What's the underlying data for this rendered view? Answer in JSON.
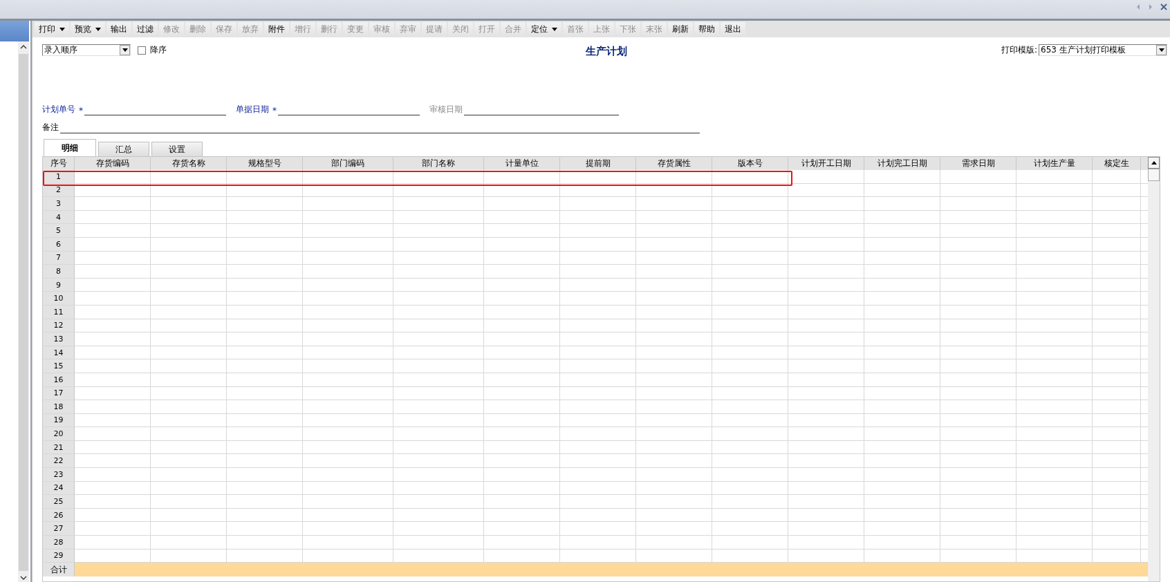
{
  "toolbar": [
    {
      "label": "打印",
      "kind": "dropdown",
      "disabled": false
    },
    {
      "label": "预览",
      "kind": "dropdown",
      "disabled": false
    },
    {
      "label": "输出",
      "kind": "button",
      "disabled": false
    },
    {
      "label": "过滤",
      "kind": "button",
      "disabled": false
    },
    {
      "label": "修改",
      "kind": "button",
      "disabled": true
    },
    {
      "label": "删除",
      "kind": "button",
      "disabled": true
    },
    {
      "label": "保存",
      "kind": "button",
      "disabled": true
    },
    {
      "label": "放弃",
      "kind": "button",
      "disabled": true
    },
    {
      "label": "附件",
      "kind": "button",
      "disabled": false
    },
    {
      "label": "增行",
      "kind": "button",
      "disabled": true
    },
    {
      "label": "删行",
      "kind": "button",
      "disabled": true
    },
    {
      "label": "变更",
      "kind": "button",
      "disabled": true
    },
    {
      "label": "审核",
      "kind": "button",
      "disabled": true
    },
    {
      "label": "弃审",
      "kind": "button",
      "disabled": true
    },
    {
      "label": "提请",
      "kind": "button",
      "disabled": true
    },
    {
      "label": "关闭",
      "kind": "button",
      "disabled": true
    },
    {
      "label": "打开",
      "kind": "button",
      "disabled": true
    },
    {
      "label": "合并",
      "kind": "button",
      "disabled": true
    },
    {
      "label": "定位",
      "kind": "dropdown",
      "disabled": false
    },
    {
      "label": "首张",
      "kind": "button",
      "disabled": true
    },
    {
      "label": "上张",
      "kind": "button",
      "disabled": true
    },
    {
      "label": "下张",
      "kind": "button",
      "disabled": true
    },
    {
      "label": "末张",
      "kind": "button",
      "disabled": true
    },
    {
      "label": "刷新",
      "kind": "button",
      "disabled": false
    },
    {
      "label": "帮助",
      "kind": "button",
      "disabled": false
    },
    {
      "label": "退出",
      "kind": "button",
      "disabled": false
    }
  ],
  "sort": {
    "value": "录入顺序",
    "descending": {
      "label": "降序",
      "checked": false
    }
  },
  "title": "生产计划",
  "print_template": {
    "label": "打印模版:",
    "value": "653 生产计划打印模板"
  },
  "fields": [
    {
      "label": "计划单号",
      "required": true,
      "required_mark": "*",
      "disabled": false
    },
    {
      "label": "单据日期",
      "required": true,
      "required_mark": "*",
      "disabled": false
    },
    {
      "label": "审核日期",
      "required": false,
      "disabled": true
    }
  ],
  "remark": {
    "label": "备注"
  },
  "tabs": [
    {
      "label": "明细",
      "selected": true
    },
    {
      "label": "汇总",
      "selected": false
    },
    {
      "label": "设置",
      "selected": false
    }
  ],
  "grid": {
    "corner_label": "序号",
    "columns": [
      "存货编码",
      "存货名称",
      "规格型号",
      "部门编码",
      "部门名称",
      "计量单位",
      "提前期",
      "存货属性",
      "版本号",
      "计划开工日期",
      "计划完工日期",
      "需求日期",
      "计划生产量",
      "核定生"
    ],
    "row_numbers": [
      "1",
      "2",
      "3",
      "4",
      "5",
      "6",
      "7",
      "8",
      "9",
      "10",
      "11",
      "12",
      "13",
      "14",
      "15",
      "16",
      "17",
      "18",
      "19",
      "20",
      "21",
      "22",
      "23",
      "24",
      "25",
      "26",
      "27",
      "28",
      "29"
    ],
    "footer_label": "合计"
  }
}
